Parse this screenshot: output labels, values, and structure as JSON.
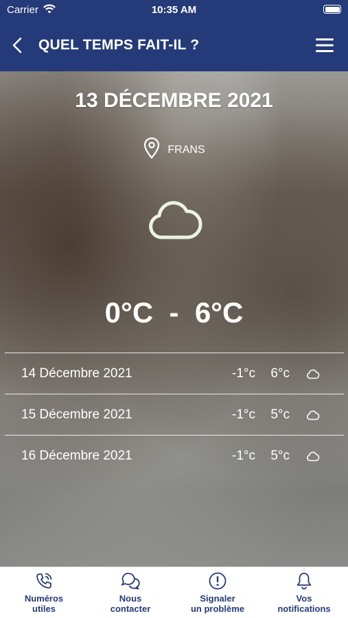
{
  "status_bar": {
    "carrier": "Carrier",
    "time": "10:35 AM"
  },
  "nav": {
    "title": "QUEL TEMPS FAIT-IL ?",
    "back_icon": "chevron-left-icon",
    "menu_icon": "hamburger-menu-icon"
  },
  "today": {
    "date": "13 DÉCEMBRE 2021",
    "location": "FRANS",
    "weather_icon": "cloud-icon",
    "temp_range": "0°C  -  6°C"
  },
  "forecast": [
    {
      "date": "14 Décembre 2021",
      "min": "-1°c",
      "max": "6°c",
      "icon": "cloud-icon"
    },
    {
      "date": "15 Décembre 2021",
      "min": "-1°c",
      "max": "5°c",
      "icon": "cloud-icon"
    },
    {
      "date": "16 Décembre 2021",
      "min": "-1°c",
      "max": "5°c",
      "icon": "cloud-icon"
    }
  ],
  "tabs": [
    {
      "label_line1": "Numéros",
      "label_line2": "utiles",
      "icon": "phone-icon"
    },
    {
      "label_line1": "Nous",
      "label_line2": "contacter",
      "icon": "chat-icon"
    },
    {
      "label_line1": "Signaler",
      "label_line2": "un problème",
      "icon": "alert-icon"
    },
    {
      "label_line1": "Vos",
      "label_line2": "notifications",
      "icon": "bell-icon"
    }
  ],
  "colors": {
    "brand": "#253a78",
    "tab_text": "#253a78",
    "text_on_image": "#ffffff"
  }
}
